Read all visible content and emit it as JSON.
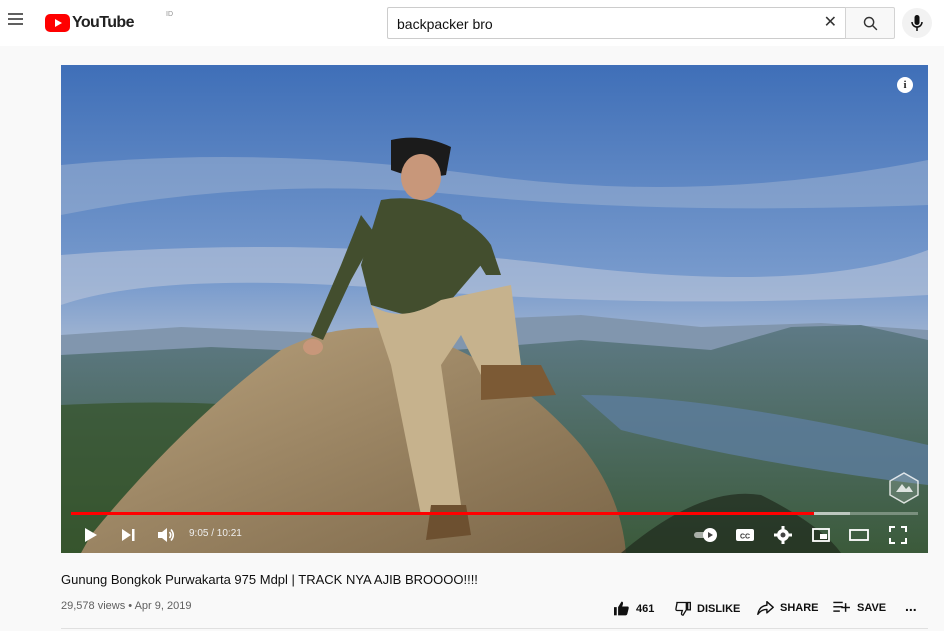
{
  "header": {
    "logo_text": "YouTube",
    "logo_country": "ID",
    "search_value": "backpacker bro",
    "icons": [
      "menu-icon",
      "youtube-logo",
      "close-icon",
      "search-icon",
      "mic-icon"
    ]
  },
  "player": {
    "current_time": "9:05",
    "duration": "10:21",
    "time_display": "9:05 / 10:21",
    "progress_played": 0.877,
    "progress_buffered": 0.92,
    "icons": [
      "info-icon",
      "play-icon",
      "next-icon",
      "volume-icon",
      "autoplay-toggle-icon",
      "captions-icon",
      "settings-icon",
      "miniplayer-icon",
      "theater-icon",
      "fullscreen-icon"
    ]
  },
  "video": {
    "title": "Gunung Bongkok Purwakarta 975 Mdpl | TRACK NYA AJIB BROOOO!!!!",
    "views": "29,578 views",
    "separator": "•",
    "date": "Apr 9, 2019",
    "meta_line": "29,578 views • Apr 9, 2019"
  },
  "actions": {
    "like_count": "461",
    "dislike_label": "DISLIKE",
    "share_label": "SHARE",
    "save_label": "SAVE",
    "more_label": "..."
  },
  "colors": {
    "accent": "#ff0000",
    "header_bg": "#ffffff",
    "page_bg": "#f9f9f9",
    "text_secondary": "#606060"
  }
}
